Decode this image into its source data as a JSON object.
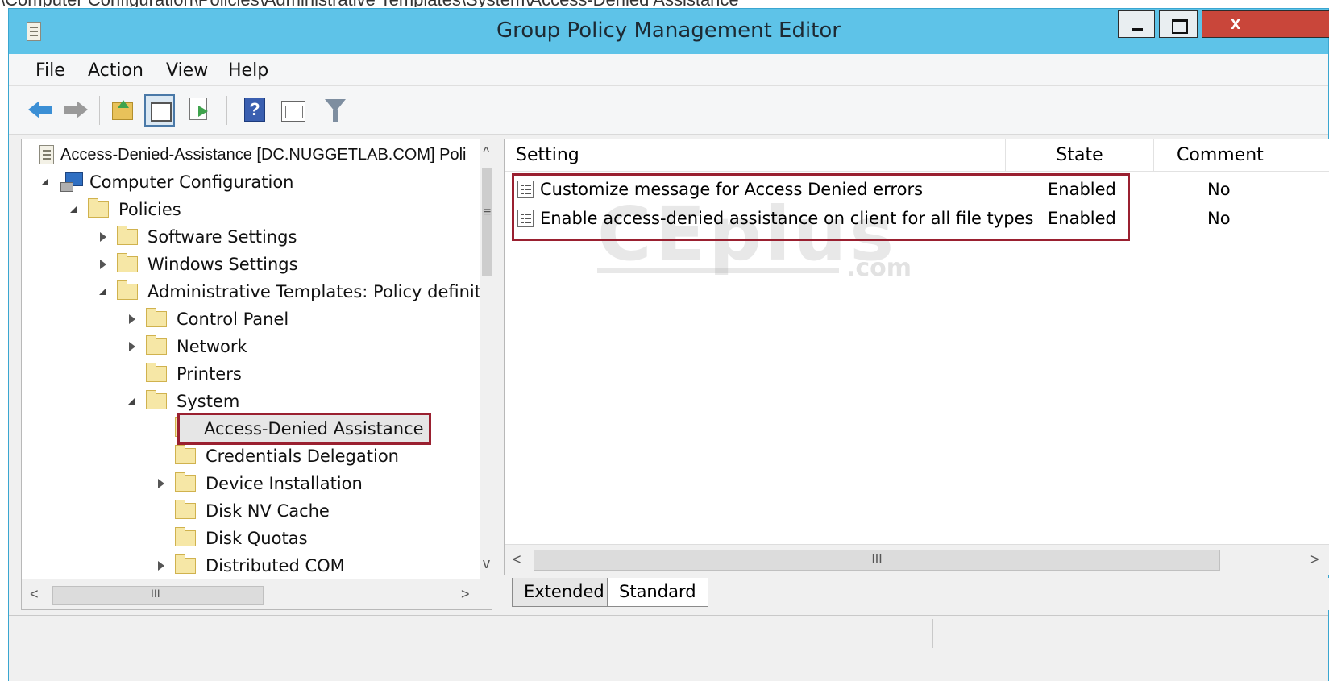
{
  "caption": "\\Computer Configuration\\Policies\\Administrative Templates\\System\\Access-Denied Assistance",
  "window": {
    "title": "Group Policy Management Editor",
    "close_glyph": "x"
  },
  "menu": {
    "file": "File",
    "action": "Action",
    "view": "View",
    "help": "Help"
  },
  "toolbar": {
    "help_glyph": "?"
  },
  "tree": {
    "root": "Access-Denied-Assistance [DC.NUGGETLAB.COM] Poli",
    "computer_configuration": "Computer Configuration",
    "policies": "Policies",
    "software_settings": "Software Settings",
    "windows_settings": "Windows Settings",
    "administrative_templates": "Administrative Templates: Policy definit",
    "control_panel": "Control Panel",
    "network": "Network",
    "printers": "Printers",
    "system": "System",
    "access_denied_assistance": "Access-Denied Assistance",
    "credentials_delegation": "Credentials Delegation",
    "device_installation": "Device Installation",
    "disk_nv_cache": "Disk NV Cache",
    "disk_quotas": "Disk Quotas",
    "distributed_com": "Distributed COM"
  },
  "scrollbars": {
    "thumb_grip": "III",
    "left_arrow": "<",
    "right_arrow": ">",
    "up_arrow": "^",
    "down_arrow": "v",
    "mid_grip": "≡"
  },
  "details": {
    "columns": {
      "setting": "Setting",
      "state": "State",
      "comment": "Comment"
    },
    "rows": [
      {
        "setting": "Customize message for Access Denied errors",
        "state": "Enabled",
        "comment": "No"
      },
      {
        "setting": "Enable access-denied assistance on client for all file types",
        "state": "Enabled",
        "comment": "No"
      }
    ]
  },
  "watermark": {
    "brand": "CEplus",
    "domain": ".com"
  },
  "tabs": {
    "extended": "Extended",
    "standard": "Standard"
  },
  "colors": {
    "title_bar": "#5ec3e8",
    "highlight_border": "#9a2030",
    "close_button": "#c9463a"
  }
}
